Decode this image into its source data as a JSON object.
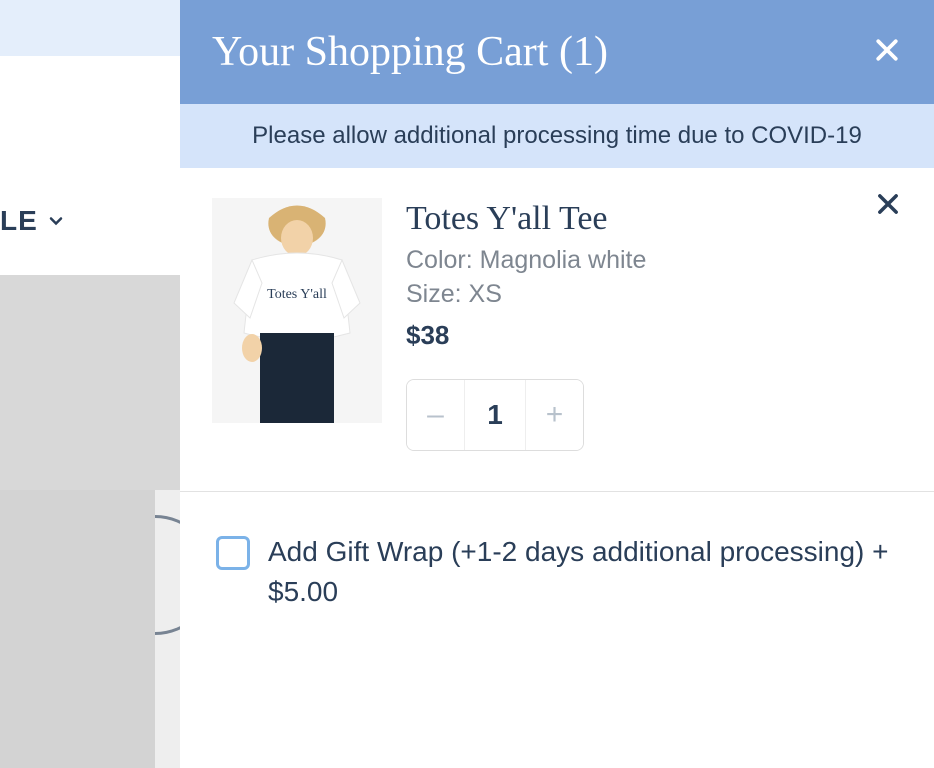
{
  "nav_fragment": "LE",
  "cart": {
    "title": "Your Shopping Cart (1)",
    "notice": "Please allow additional processing time due to COVID-19",
    "items": [
      {
        "name": "Totes Y'all Tee",
        "color_line": "Color: Magnolia white",
        "size_line": "Size: XS",
        "price": "$38",
        "qty": "1",
        "thumb_text": "Totes Y'all"
      }
    ],
    "gift_wrap_label": "Add Gift Wrap (+1-2 days additional processing) + $5.00"
  }
}
